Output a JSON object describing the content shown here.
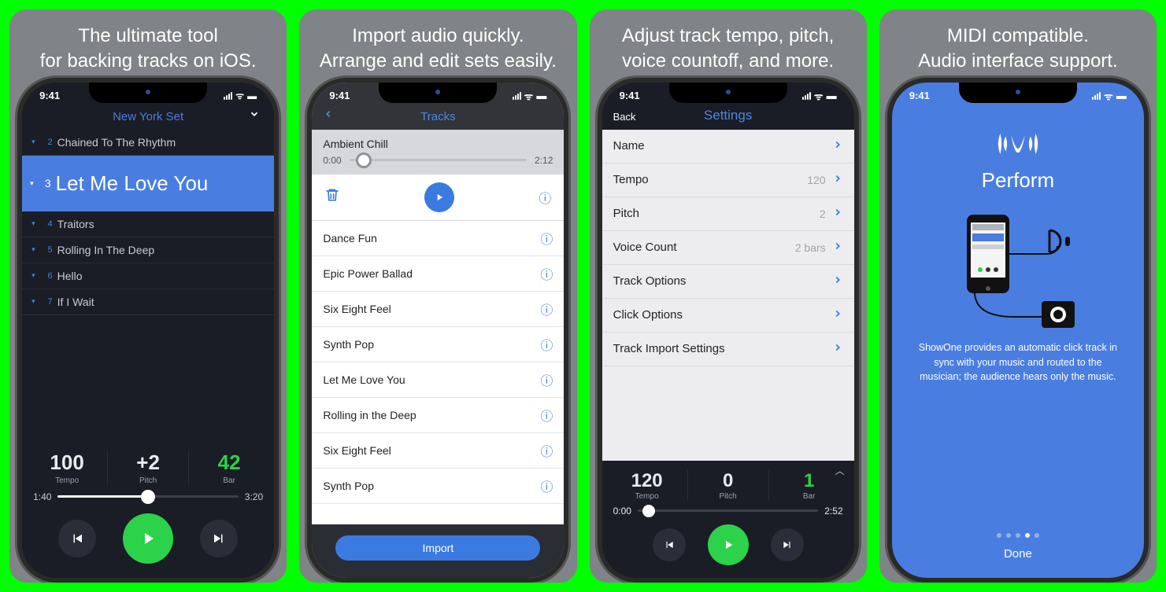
{
  "status_time": "9:41",
  "panel1": {
    "caption_l1": "The ultimate tool",
    "caption_l2": "for backing tracks on iOS.",
    "set_title": "New York Set",
    "rows": [
      {
        "num": "2",
        "name": "Chained To The Rhythm"
      },
      {
        "num": "3",
        "name": "Let Me Love You",
        "hero": true
      },
      {
        "num": "4",
        "name": "Traitors"
      },
      {
        "num": "5",
        "name": "Rolling In The Deep"
      },
      {
        "num": "6",
        "name": "Hello"
      },
      {
        "num": "7",
        "name": "If I Wait"
      }
    ],
    "tempo_v": "100",
    "tempo_l": "Tempo",
    "pitch_v": "+2",
    "pitch_l": "Pitch",
    "bar_v": "42",
    "bar_l": "Bar",
    "time_cur": "1:40",
    "time_total": "3:20",
    "progress_pct": 50
  },
  "panel2": {
    "caption_l1": "Import audio quickly.",
    "caption_l2": "Arrange and edit sets easily.",
    "header": "Tracks",
    "preview_name": "Ambient Chill",
    "preview_start": "0:00",
    "preview_end": "2:12",
    "tracks": [
      "Dance Fun",
      "Epic Power Ballad",
      "Six Eight Feel",
      "Synth Pop",
      "Let Me Love You",
      "Rolling in the Deep",
      "Six Eight Feel",
      "Synth Pop"
    ],
    "import_label": "Import"
  },
  "panel3": {
    "caption_l1": "Adjust track tempo, pitch,",
    "caption_l2": "voice countoff, and more.",
    "back": "Back",
    "header": "Settings",
    "items": [
      {
        "label": "Name",
        "val": ""
      },
      {
        "label": "Tempo",
        "val": "120"
      },
      {
        "label": "Pitch",
        "val": "2"
      },
      {
        "label": "Voice Count",
        "val": "2 bars"
      },
      {
        "label": "Track Options",
        "val": ""
      },
      {
        "label": "Click Options",
        "val": ""
      },
      {
        "label": "Track Import Settings",
        "val": ""
      }
    ],
    "tempo_v": "120",
    "tempo_l": "Tempo",
    "pitch_v": "0",
    "pitch_l": "Pitch",
    "bar_v": "1",
    "bar_l": "Bar",
    "time_cur": "0:00",
    "time_total": "2:52"
  },
  "panel4": {
    "caption_l1": "MIDI compatible.",
    "caption_l2": "Audio interface support.",
    "appname": "Perform",
    "blurb": "ShowOne provides an automatic click track in sync with your music and routed to the musician; the audience hears only the music.",
    "done": "Done",
    "active_dot": 3,
    "dots": 5
  }
}
